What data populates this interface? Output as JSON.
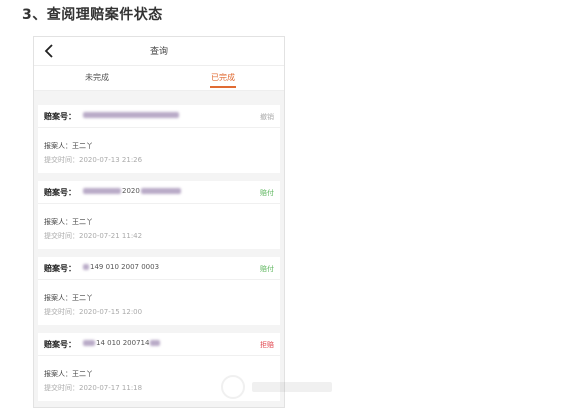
{
  "doc": {
    "heading": "3、查阅理赔案件状态"
  },
  "nav": {
    "title": "查询"
  },
  "tabs": [
    {
      "label": "未完成"
    },
    {
      "label": "已完成"
    }
  ],
  "labels": {
    "claim_no": "赔案号：",
    "reporter": "报案人：",
    "submit_time": "提交时间："
  },
  "cards": [
    {
      "claim_no_visible": "",
      "status": "撤销",
      "status_color": "#aaaaaa",
      "reporter": "王二丫",
      "time": "2020-07-13 21:26"
    },
    {
      "claim_no_visible": "2020",
      "status": "赔付",
      "status_color": "#5bb55b",
      "reporter": "王二丫",
      "time": "2020-07-21 11:42"
    },
    {
      "claim_no_visible": "149 010 2007 0003",
      "status": "赔付",
      "status_color": "#5bb55b",
      "reporter": "王二丫",
      "time": "2020-07-15 12:00"
    },
    {
      "claim_no_visible": "14 010 200714",
      "status": "拒赔",
      "status_color": "#e0414a",
      "reporter": "王二丫",
      "time": "2020-07-17 11:18"
    }
  ]
}
